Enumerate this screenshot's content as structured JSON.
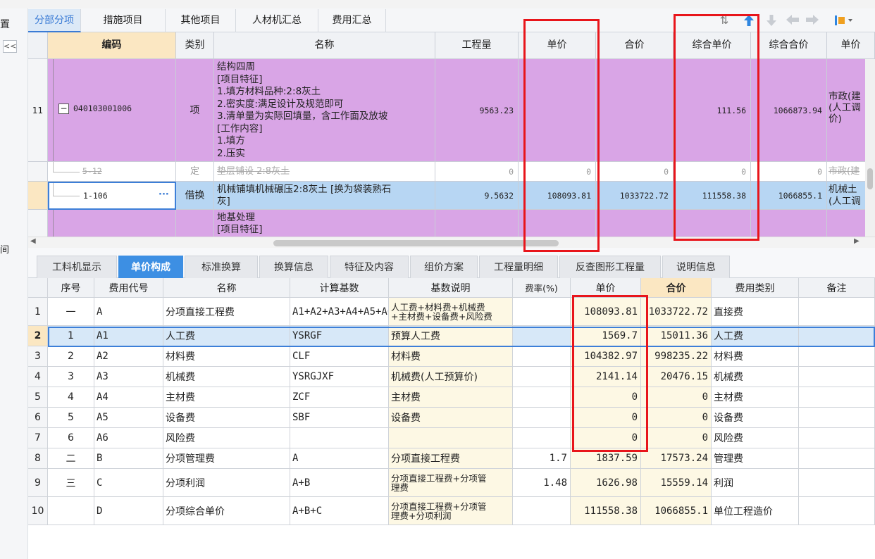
{
  "left_panel": {
    "label_top": "置",
    "collapse": "<<",
    "label_mid": "间"
  },
  "top_tabs": [
    "分部分项",
    "措施项目",
    "其他项目",
    "人材机汇总",
    "费用汇总"
  ],
  "toolbar_icons": [
    "sort-icon",
    "arrow-up-icon",
    "arrow-down-icon",
    "arrow-left-icon",
    "arrow-right-icon",
    "settings-icon"
  ],
  "upper_grid": {
    "headers": [
      "编码",
      "类别",
      "名称",
      "工程量",
      "单价",
      "合价",
      "综合单价",
      "综合合价",
      "单价"
    ],
    "rows": [
      {
        "index": "11",
        "toggle": "−",
        "code": "040103001006",
        "category": "项",
        "name_lines": [
          "结构四周",
          "[项目特征]",
          "1.填方材料品种:2:8灰土",
          "2.密实度:满足设计及规范即可",
          "3.清单量为实际回填量，含工作面及放坡",
          "[工作内容]",
          "1.填方",
          "2.压实"
        ],
        "quantity": "9563.23",
        "unit_price": "",
        "total": "",
        "comp_unit_price": "111.56",
        "comp_total": "1066873.94",
        "price_note": [
          "市政(建",
          "(人工调",
          "价)"
        ]
      },
      {
        "index": "",
        "code": "5-12",
        "category": "定",
        "name_lines": [
          "垫层铺设 2:8灰土"
        ],
        "quantity": "0",
        "unit_price": "0",
        "total": "0",
        "comp_unit_price": "0",
        "comp_total": "0",
        "price_note": [
          "市政(建"
        ]
      },
      {
        "index": "",
        "code": "1-106",
        "more": "···",
        "category": "借换",
        "name_lines": [
          "机械铺填机械碾压2:8灰土  [换为袋装熟石",
          "灰]"
        ],
        "quantity": "9.5632",
        "unit_price": "108093.81",
        "total": "1033722.72",
        "comp_unit_price": "111558.38",
        "comp_total": "1066855.1",
        "price_note": [
          "机械土",
          "(人工调"
        ]
      },
      {
        "index": "",
        "code": "",
        "category": "",
        "name_lines": [
          "地基处理",
          "[项目特征]"
        ],
        "quantity": "",
        "unit_price": "",
        "total": "",
        "comp_unit_price": "",
        "comp_total": "",
        "price_note": []
      }
    ]
  },
  "bottom_tabs": [
    "工料机显示",
    "单价构成",
    "标准换算",
    "换算信息",
    "特征及内容",
    "组价方案",
    "工程量明细",
    "反查图形工程量",
    "说明信息"
  ],
  "lower_grid": {
    "headers": [
      "序号",
      "费用代号",
      "名称",
      "计算基数",
      "基数说明",
      "费率(%)",
      "单价",
      "合价",
      "费用类别",
      "备注"
    ],
    "rows": [
      {
        "idx": "1",
        "seq": "一",
        "code": "A",
        "name": "分项直接工程费",
        "base": "A1+A2+A3+A4+A5+A6",
        "desc": [
          "人工费+材料费+机械费",
          "+主材费+设备费+风险费"
        ],
        "rate": "",
        "price": "108093.81",
        "total": "1033722.72",
        "type": "直接费",
        "note": ""
      },
      {
        "idx": "2",
        "seq": "1",
        "code": "A1",
        "name": "人工费",
        "base": "YSRGF",
        "desc": [
          "预算人工费"
        ],
        "rate": "",
        "price": "1569.7",
        "total": "15011.36",
        "type": "人工费",
        "note": ""
      },
      {
        "idx": "3",
        "seq": "2",
        "code": "A2",
        "name": "材料费",
        "base": "CLF",
        "desc": [
          "材料费"
        ],
        "rate": "",
        "price": "104382.97",
        "total": "998235.22",
        "type": "材料费",
        "note": ""
      },
      {
        "idx": "4",
        "seq": "3",
        "code": "A3",
        "name": "机械费",
        "base": "YSRGJXF",
        "desc": [
          "机械费(人工预算价)"
        ],
        "rate": "",
        "price": "2141.14",
        "total": "20476.15",
        "type": "机械费",
        "note": ""
      },
      {
        "idx": "5",
        "seq": "4",
        "code": "A4",
        "name": "主材费",
        "base": "ZCF",
        "desc": [
          "主材费"
        ],
        "rate": "",
        "price": "0",
        "total": "0",
        "type": "主材费",
        "note": ""
      },
      {
        "idx": "6",
        "seq": "5",
        "code": "A5",
        "name": "设备费",
        "base": "SBF",
        "desc": [
          "设备费"
        ],
        "rate": "",
        "price": "0",
        "total": "0",
        "type": "设备费",
        "note": ""
      },
      {
        "idx": "7",
        "seq": "6",
        "code": "A6",
        "name": "风险费",
        "base": "",
        "desc": [
          ""
        ],
        "rate": "",
        "price": "0",
        "total": "0",
        "type": "风险费",
        "note": ""
      },
      {
        "idx": "8",
        "seq": "二",
        "code": "B",
        "name": "分项管理费",
        "base": "A",
        "desc": [
          "分项直接工程费"
        ],
        "rate": "1.7",
        "price": "1837.59",
        "total": "17573.24",
        "type": "管理费",
        "note": ""
      },
      {
        "idx": "9",
        "seq": "三",
        "code": "C",
        "name": "分项利润",
        "base": "A+B",
        "desc": [
          "分项直接工程费+分项管",
          "理费"
        ],
        "rate": "1.48",
        "price": "1626.98",
        "total": "15559.14",
        "type": "利润",
        "note": ""
      },
      {
        "idx": "10",
        "seq": "",
        "code": "D",
        "name": "分项综合单价",
        "base": "A+B+C",
        "desc": [
          "分项直接工程费+分项管",
          "理费+分项利润"
        ],
        "rate": "",
        "price": "111558.38",
        "total": "1066855.1",
        "type": "单位工程造价",
        "note": ""
      }
    ]
  },
  "colors": {
    "purple_row": "#d9a5e6",
    "selected_row": "#b7d6f3",
    "accent": "#3d8fe3",
    "highlight": "#e8151b"
  }
}
